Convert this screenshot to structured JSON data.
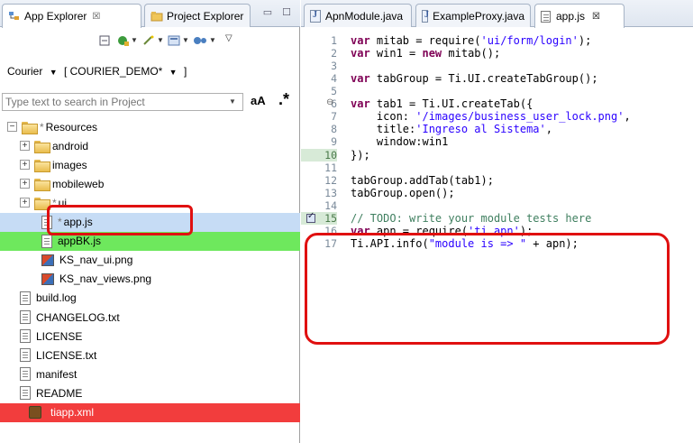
{
  "left_tabs": [
    {
      "label": "App Explorer",
      "close": "☒"
    },
    {
      "label": "Project Explorer",
      "close": ""
    }
  ],
  "view_buttons": "▭ ☐",
  "project": {
    "label": "Courier",
    "branch": "[ COURIER_DEMO*",
    "suffix": "]"
  },
  "search": {
    "placeholder": "Type text to search in Project",
    "case_label": "aA",
    "regex_label": ".*"
  },
  "tree": [
    {
      "label": "Resources",
      "dirty": true,
      "type": "folder",
      "indent": 0,
      "expand": "⊟"
    },
    {
      "label": "android",
      "type": "folder",
      "indent": 1,
      "expand": "⊞"
    },
    {
      "label": "images",
      "type": "folder",
      "indent": 1,
      "expand": "⊞"
    },
    {
      "label": "mobileweb",
      "type": "folder",
      "indent": 1,
      "expand": "⊞"
    },
    {
      "label": "ui",
      "dirty": true,
      "type": "folder",
      "indent": 1,
      "expand": "⊞"
    },
    {
      "label": "app.js",
      "dirty": true,
      "type": "file",
      "indent": 2,
      "highlight": "blue"
    },
    {
      "label": "appBK.js",
      "type": "file",
      "indent": 2,
      "highlight": "green"
    },
    {
      "label": "KS_nav_ui.png",
      "type": "png",
      "indent": 2
    },
    {
      "label": "KS_nav_views.png",
      "type": "png",
      "indent": 2
    },
    {
      "label": "build.log",
      "type": "file",
      "indent": 1
    },
    {
      "label": "CHANGELOG.txt",
      "type": "file",
      "indent": 1
    },
    {
      "label": "LICENSE",
      "type": "file",
      "indent": 1
    },
    {
      "label": "LICENSE.txt",
      "type": "file",
      "indent": 1
    },
    {
      "label": "manifest",
      "type": "file",
      "indent": 1
    },
    {
      "label": "README",
      "type": "file",
      "indent": 1
    },
    {
      "label": "tiapp.xml",
      "type": "xml",
      "indent": 1,
      "highlight": "red"
    }
  ],
  "editor_tabs": [
    {
      "label": "ApnModule.java"
    },
    {
      "label": "ExampleProxy.java"
    },
    {
      "label": "app.js",
      "close": "☒",
      "active": true
    }
  ],
  "code_lines": [
    {
      "n": "1",
      "parts": [
        [
          "kw",
          "var"
        ],
        [
          "t",
          " mitab = require("
        ],
        [
          "str",
          "'ui/form/login'"
        ],
        [
          "t",
          ");"
        ]
      ]
    },
    {
      "n": "2",
      "parts": [
        [
          "kw",
          "var"
        ],
        [
          "t",
          " win1 = "
        ],
        [
          "kw",
          "new"
        ],
        [
          "t",
          " mitab();"
        ]
      ]
    },
    {
      "n": "3",
      "parts": []
    },
    {
      "n": "4",
      "parts": [
        [
          "kw",
          "var"
        ],
        [
          "t",
          " tabGroup = Ti.UI.createTabGroup();"
        ]
      ]
    },
    {
      "n": "5",
      "parts": []
    },
    {
      "n": "6",
      "fold": true,
      "parts": [
        [
          "kw",
          "var"
        ],
        [
          "t",
          " tab1 = Ti.UI.createTab({"
        ]
      ]
    },
    {
      "n": "7",
      "parts": [
        [
          "t",
          "    icon: "
        ],
        [
          "str",
          "'/images/business_user_lock.png'"
        ],
        [
          "t",
          ","
        ]
      ]
    },
    {
      "n": "8",
      "parts": [
        [
          "t",
          "    title:"
        ],
        [
          "str",
          "'Ingreso al Sistema'"
        ],
        [
          "t",
          ","
        ]
      ]
    },
    {
      "n": "9",
      "parts": [
        [
          "t",
          "    window:win1"
        ]
      ]
    },
    {
      "n": "10",
      "hl": true,
      "parts": [
        [
          "t",
          "});"
        ]
      ]
    },
    {
      "n": "11",
      "parts": []
    },
    {
      "n": "12",
      "parts": [
        [
          "t",
          "tabGroup.addTab(tab1);"
        ]
      ]
    },
    {
      "n": "13",
      "parts": [
        [
          "t",
          "tabGroup.open();"
        ]
      ]
    },
    {
      "n": "14",
      "parts": []
    },
    {
      "n": "15",
      "hl": true,
      "task": true,
      "parts": [
        [
          "cmt",
          "// TODO: write your module tests here"
        ]
      ]
    },
    {
      "n": "16",
      "parts": [
        [
          "kw",
          "var"
        ],
        [
          "t",
          " apn = require("
        ],
        [
          "str",
          "'ti.apn'"
        ],
        [
          "t",
          ");"
        ]
      ]
    },
    {
      "n": "17",
      "parts": [
        [
          "t",
          "Ti.API.info("
        ],
        [
          "str",
          "\"module is => \""
        ],
        [
          "t",
          " + apn);"
        ]
      ]
    }
  ],
  "colors": {
    "keyword": "#7f0055",
    "string": "#2a00ff",
    "comment": "#3f7f5f",
    "annotation": "#e01010"
  }
}
